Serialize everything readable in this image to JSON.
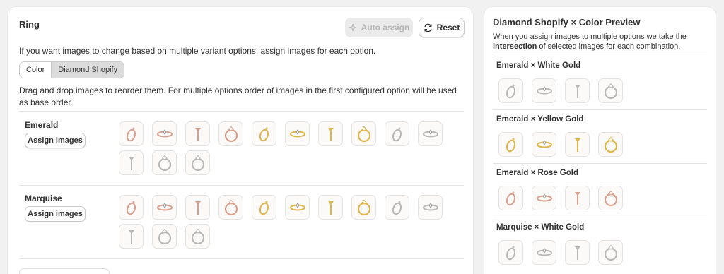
{
  "left_card": {
    "title": "Ring",
    "auto_assign_label": "Auto assign",
    "reset_label": "Reset",
    "intro_text": "If you want images to change based on multiple variant options, assign images for each option.",
    "segments": [
      {
        "label": "Color",
        "active": false
      },
      {
        "label": "Diamond Shopify",
        "active": true
      }
    ],
    "drag_text": "Drag and drop images to reorder them. For multiple options order of images in the first configured option will be used as base order.",
    "options": [
      {
        "name": "Emerald",
        "button_label": "Assign images",
        "thumbnails": [
          {
            "icon": "ring-side-icon",
            "metal": "rose"
          },
          {
            "icon": "ring-band-icon",
            "metal": "rose"
          },
          {
            "icon": "ring-profile-icon",
            "metal": "rose"
          },
          {
            "icon": "ring-front-icon",
            "metal": "rose"
          },
          {
            "icon": "ring-side-icon",
            "metal": "yellow"
          },
          {
            "icon": "ring-band-icon",
            "metal": "yellow"
          },
          {
            "icon": "ring-profile-icon",
            "metal": "yellow"
          },
          {
            "icon": "ring-front-icon",
            "metal": "yellow"
          },
          {
            "icon": "ring-side-icon",
            "metal": "white"
          },
          {
            "icon": "ring-band-icon",
            "metal": "white"
          },
          {
            "icon": "ring-profile-icon",
            "metal": "white"
          },
          {
            "icon": "ring-front-icon",
            "metal": "white"
          }
        ]
      },
      {
        "name": "Marquise",
        "button_label": "Assign images",
        "thumbnails": [
          {
            "icon": "ring-side-icon",
            "metal": "rose"
          },
          {
            "icon": "ring-band-icon",
            "metal": "rose"
          },
          {
            "icon": "ring-profile-icon",
            "metal": "rose"
          },
          {
            "icon": "ring-front-icon",
            "metal": "rose"
          },
          {
            "icon": "ring-side-icon",
            "metal": "yellow"
          },
          {
            "icon": "ring-band-icon",
            "metal": "yellow"
          },
          {
            "icon": "ring-profile-icon",
            "metal": "yellow"
          },
          {
            "icon": "ring-front-icon",
            "metal": "yellow"
          },
          {
            "icon": "ring-side-icon",
            "metal": "white"
          },
          {
            "icon": "ring-band-icon",
            "metal": "white"
          },
          {
            "icon": "ring-profile-icon",
            "metal": "white"
          },
          {
            "icon": "ring-front-icon",
            "metal": "white"
          }
        ]
      }
    ]
  },
  "right_card": {
    "title": "Diamond Shopify × Color Preview",
    "desc_prefix": "When you assign images to multiple options we take the ",
    "desc_bold": "intersection",
    "desc_suffix": " of selected images for each combination.",
    "combinations": [
      {
        "label": "Emerald × White Gold",
        "metal": "white"
      },
      {
        "label": "Emerald × Yellow Gold",
        "metal": "yellow"
      },
      {
        "label": "Emerald × Rose Gold",
        "metal": "rose"
      },
      {
        "label": "Marquise × White Gold",
        "metal": "white"
      }
    ]
  },
  "metal_colors": {
    "rose": "#d9a08e",
    "yellow": "#e0b54a",
    "white": "#b8b8b8"
  }
}
